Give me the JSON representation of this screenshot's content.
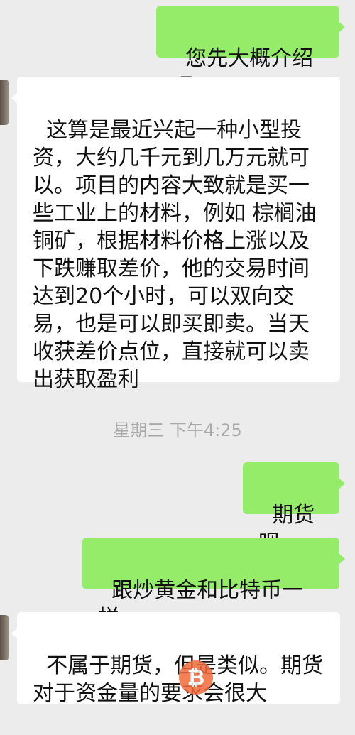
{
  "messages": [
    {
      "id": "m1",
      "direction": "outgoing",
      "text": "您先大概介绍吧"
    },
    {
      "id": "m2",
      "direction": "incoming",
      "text": "这算是最近兴起一种小型投资，大约几千元到几万元就可以。项目的内容大致就是买一些工业上的材料，例如 棕榈油 铜矿，根据材料价格上涨以及下跌赚取差价，他的交易时间达到20个小时，可以双向交易，也是可以即买即卖。当天收获差价点位，直接就可以卖出获取盈利"
    },
    {
      "id": "m3",
      "direction": "timestamp",
      "text": "星期三 下午4:25"
    },
    {
      "id": "m4",
      "direction": "outgoing",
      "text": "期货呗"
    },
    {
      "id": "m5",
      "direction": "outgoing",
      "text": "跟炒黄金和比特币一样"
    },
    {
      "id": "m6",
      "direction": "incoming",
      "text": "不属于期货，但是类似。期货对于资金量的要求会很大"
    }
  ],
  "watermark": {
    "icon": "bitcoin-logo",
    "symbol": "₿",
    "color": "#f26b3a"
  },
  "colors": {
    "background": "#ececec",
    "outgoing_bubble": "#95ec69",
    "incoming_bubble": "#ffffff",
    "timestamp": "#a9a9a9"
  }
}
